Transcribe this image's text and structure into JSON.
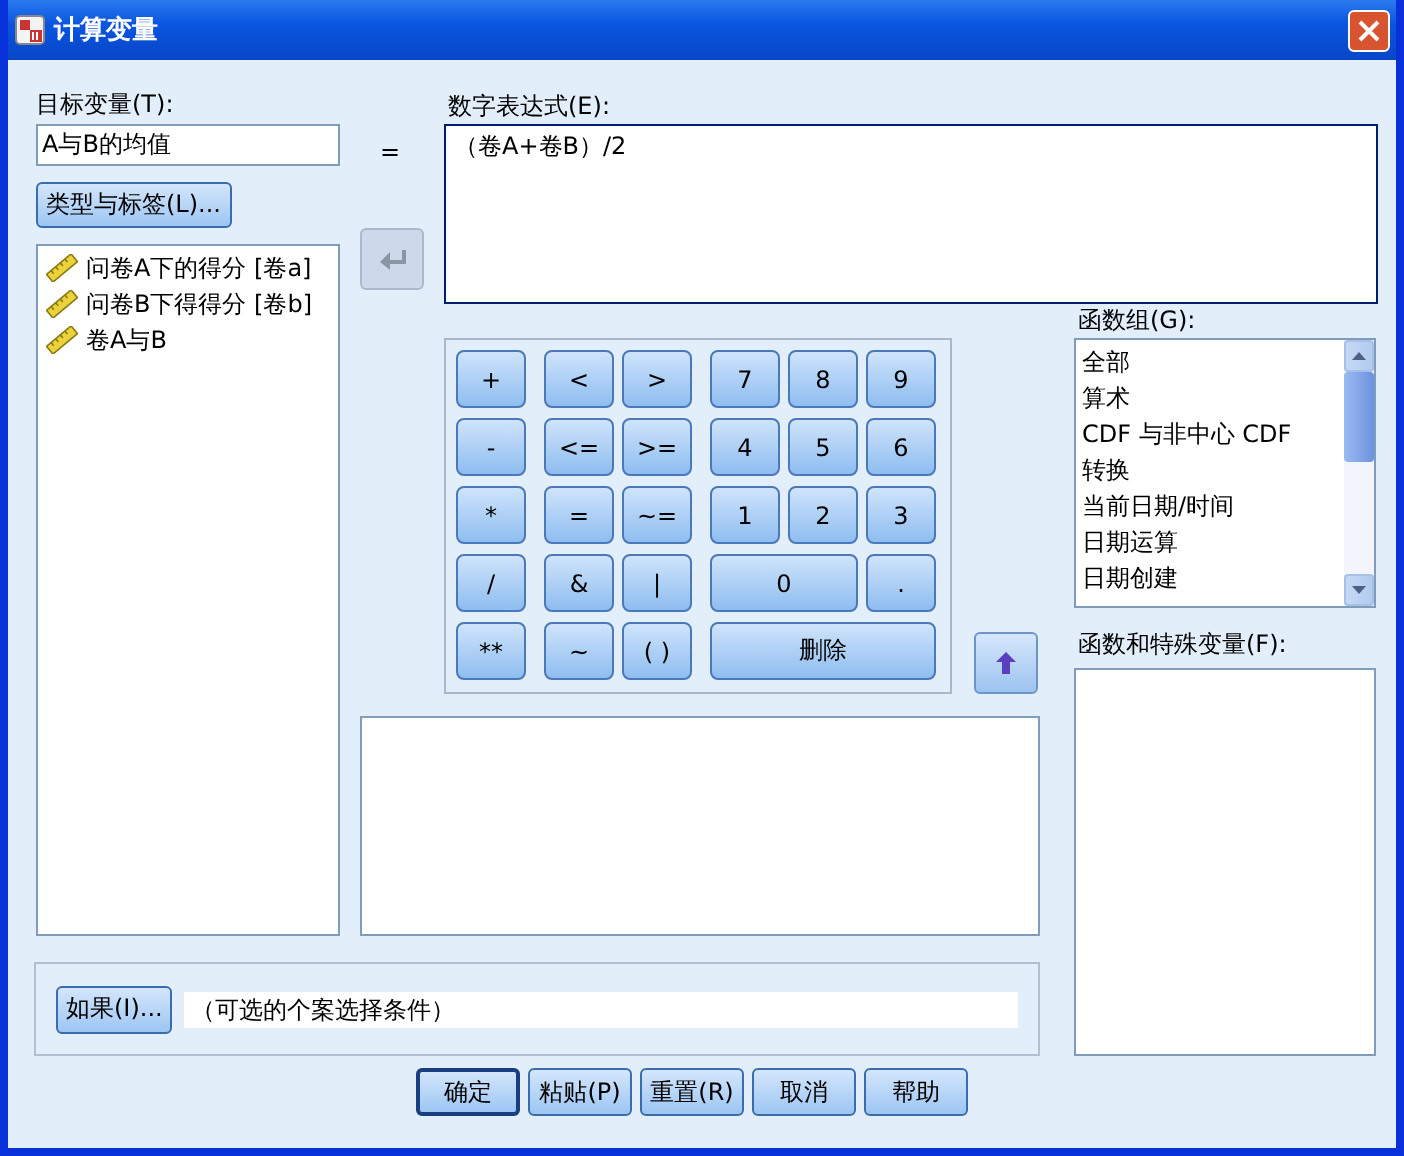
{
  "window": {
    "title": "计算变量"
  },
  "target": {
    "label": "目标变量(T):",
    "value": "A与B的均值",
    "equals": "=",
    "type_button": "类型与标签(L)..."
  },
  "variables": [
    {
      "name": "问卷A下的得分 [卷a]"
    },
    {
      "name": "问卷B下得得分 [卷b]"
    },
    {
      "name": "卷A与B"
    }
  ],
  "transfer_button": {
    "disabled": true
  },
  "expression": {
    "label": "数字表达式(E):",
    "value": "（卷A+卷B）/2"
  },
  "keypad": [
    {
      "ops": [
        "+",
        "<",
        ">"
      ],
      "digits": [
        "7",
        "8",
        "9"
      ]
    },
    {
      "ops": [
        "-",
        "<=",
        ">="
      ],
      "digits": [
        "4",
        "5",
        "6"
      ]
    },
    {
      "ops": [
        "*",
        "=",
        "~="
      ],
      "digits": [
        "1",
        "2",
        "3"
      ]
    },
    {
      "ops": [
        "/",
        "&",
        "|"
      ],
      "digits": [
        "0",
        "."
      ]
    },
    {
      "ops": [
        "**",
        "~",
        "( )"
      ],
      "digits": [
        "删除"
      ]
    }
  ],
  "function_up_button": {
    "disabled": false
  },
  "function_groups": {
    "label": "函数组(G):",
    "items": [
      {
        "label": "全部",
        "selected": false
      },
      {
        "label": "算术",
        "selected": false
      },
      {
        "label": "CDF 与非中心 CDF",
        "selected": false
      },
      {
        "label": "转换",
        "selected": false
      },
      {
        "label": "当前日期/时间",
        "selected": false
      },
      {
        "label": "日期运算",
        "selected": false
      },
      {
        "label": "日期创建",
        "selected": false
      }
    ]
  },
  "functions": {
    "label": "函数和特殊变量(F):"
  },
  "condition": {
    "button": "如果(I)...",
    "value": "（可选的个案选择条件）"
  },
  "buttons": [
    {
      "label": "确定",
      "default": true
    },
    {
      "label": "粘贴(P)",
      "default": false
    },
    {
      "label": "重置(R)",
      "default": false
    },
    {
      "label": "取消",
      "default": false
    },
    {
      "label": "帮助",
      "default": false
    }
  ]
}
